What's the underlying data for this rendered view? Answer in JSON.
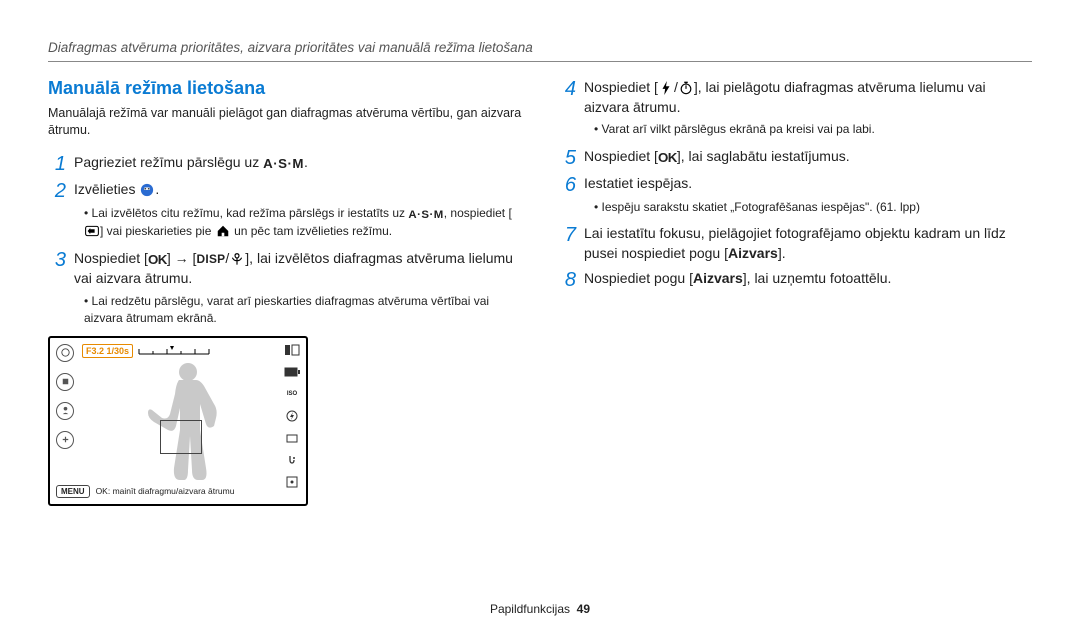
{
  "running_header": "Diafragmas atvēruma prioritātes, aizvara prioritātes vai manuālā režīma lietošana",
  "section_title": "Manuālā režīma lietošana",
  "intro": "Manuālajā režīmā var manuāli pielāgot gan diafragmas atvēruma vērtību, gan aizvara ātrumu.",
  "glyphs": {
    "asm": "A·S·M",
    "ok": "OK",
    "disp": "DISP"
  },
  "left_steps": {
    "s1": {
      "num": "1",
      "pre": "Pagrieziet režīmu pārslēgu uz ",
      "post": "."
    },
    "s2": {
      "num": "2",
      "pre": "Izvēlieties ",
      "post": "."
    },
    "s2_b1_a": "Lai izvēlētos citu režīmu, kad režīma pārslēgs ir iestatīts uz ",
    "s2_b1_b": ", nospiediet [",
    "s2_b1_c": "] vai pieskarieties pie ",
    "s2_b1_d": " un pēc tam izvēlieties režīmu.",
    "s3": {
      "num": "3",
      "pre": "Nospiediet [",
      "mid1": "] → [",
      "mid2": "/",
      "post": "], lai izvēlētos diafragmas atvēruma lielumu vai aizvara ātrumu."
    },
    "s3_b1": "Lai redzētu pārslēgu, varat arī pieskarties diafragmas atvēruma vērtībai vai aizvara ātrumam ekrānā."
  },
  "right_steps": {
    "s4": {
      "num": "4",
      "pre": "Nospiediet [",
      "mid": "/",
      "post": "], lai pielāgotu diafragmas atvēruma lielumu vai aizvara ātrumu."
    },
    "s4_b1": "Varat arī vilkt pārslēgus ekrānā pa kreisi vai pa labi.",
    "s5": {
      "num": "5",
      "pre": "Nospiediet [",
      "post": "], lai saglabātu iestatījumus."
    },
    "s6": {
      "num": "6",
      "text": "Iestatiet iespējas."
    },
    "s6_b1": "Iespēju sarakstu skatiet „Fotografēšanas iespējas\". (61. lpp)",
    "s7": {
      "num": "7",
      "pre": "Lai iestatītu fokusu, pielāgojiet fotografējamo objektu kadram un līdz pusei nospiediet pogu [",
      "key": "Aizvars",
      "post": "]."
    },
    "s8": {
      "num": "8",
      "pre": "Nospiediet pogu [",
      "key": "Aizvars",
      "post": "], lai uzņemtu fotoattēlu."
    }
  },
  "lcd": {
    "fno": "F3.2 1/30s",
    "menu": "MENU",
    "caption": "OK: mainīt diafragmu/aizvara ātrumu"
  },
  "footer": {
    "label": "Papildfunkcijas",
    "page": "49"
  }
}
